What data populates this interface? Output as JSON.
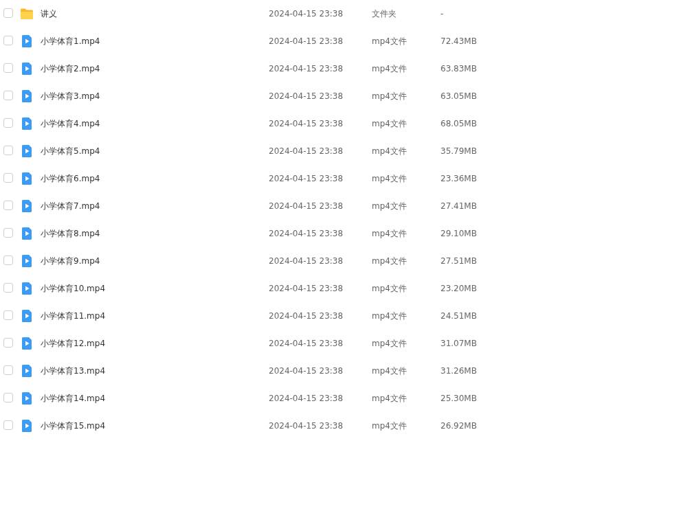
{
  "files": [
    {
      "kind": "folder",
      "name": "讲义",
      "modified": "2024-04-15 23:38",
      "type": "文件夹",
      "size": "-",
      "checked": false
    },
    {
      "kind": "video",
      "name": "小学体育1.mp4",
      "modified": "2024-04-15 23:38",
      "type": "mp4文件",
      "size": "72.43MB",
      "checked": false
    },
    {
      "kind": "video",
      "name": "小学体育2.mp4",
      "modified": "2024-04-15 23:38",
      "type": "mp4文件",
      "size": "63.83MB",
      "checked": false
    },
    {
      "kind": "video",
      "name": "小学体育3.mp4",
      "modified": "2024-04-15 23:38",
      "type": "mp4文件",
      "size": "63.05MB",
      "checked": false
    },
    {
      "kind": "video",
      "name": "小学体育4.mp4",
      "modified": "2024-04-15 23:38",
      "type": "mp4文件",
      "size": "68.05MB",
      "checked": false
    },
    {
      "kind": "video",
      "name": "小学体育5.mp4",
      "modified": "2024-04-15 23:38",
      "type": "mp4文件",
      "size": "35.79MB",
      "checked": false
    },
    {
      "kind": "video",
      "name": "小学体育6.mp4",
      "modified": "2024-04-15 23:38",
      "type": "mp4文件",
      "size": "23.36MB",
      "checked": false
    },
    {
      "kind": "video",
      "name": "小学体育7.mp4",
      "modified": "2024-04-15 23:38",
      "type": "mp4文件",
      "size": "27.41MB",
      "checked": false
    },
    {
      "kind": "video",
      "name": "小学体育8.mp4",
      "modified": "2024-04-15 23:38",
      "type": "mp4文件",
      "size": "29.10MB",
      "checked": false
    },
    {
      "kind": "video",
      "name": "小学体育9.mp4",
      "modified": "2024-04-15 23:38",
      "type": "mp4文件",
      "size": "27.51MB",
      "checked": false
    },
    {
      "kind": "video",
      "name": "小学体育10.mp4",
      "modified": "2024-04-15 23:38",
      "type": "mp4文件",
      "size": "23.20MB",
      "checked": false
    },
    {
      "kind": "video",
      "name": "小学体育11.mp4",
      "modified": "2024-04-15 23:38",
      "type": "mp4文件",
      "size": "24.51MB",
      "checked": false
    },
    {
      "kind": "video",
      "name": "小学体育12.mp4",
      "modified": "2024-04-15 23:38",
      "type": "mp4文件",
      "size": "31.07MB",
      "checked": false
    },
    {
      "kind": "video",
      "name": "小学体育13.mp4",
      "modified": "2024-04-15 23:38",
      "type": "mp4文件",
      "size": "31.26MB",
      "checked": false
    },
    {
      "kind": "video",
      "name": "小学体育14.mp4",
      "modified": "2024-04-15 23:38",
      "type": "mp4文件",
      "size": "25.30MB",
      "checked": false
    },
    {
      "kind": "video",
      "name": "小学体育15.mp4",
      "modified": "2024-04-15 23:38",
      "type": "mp4文件",
      "size": "26.92MB",
      "checked": false
    }
  ]
}
